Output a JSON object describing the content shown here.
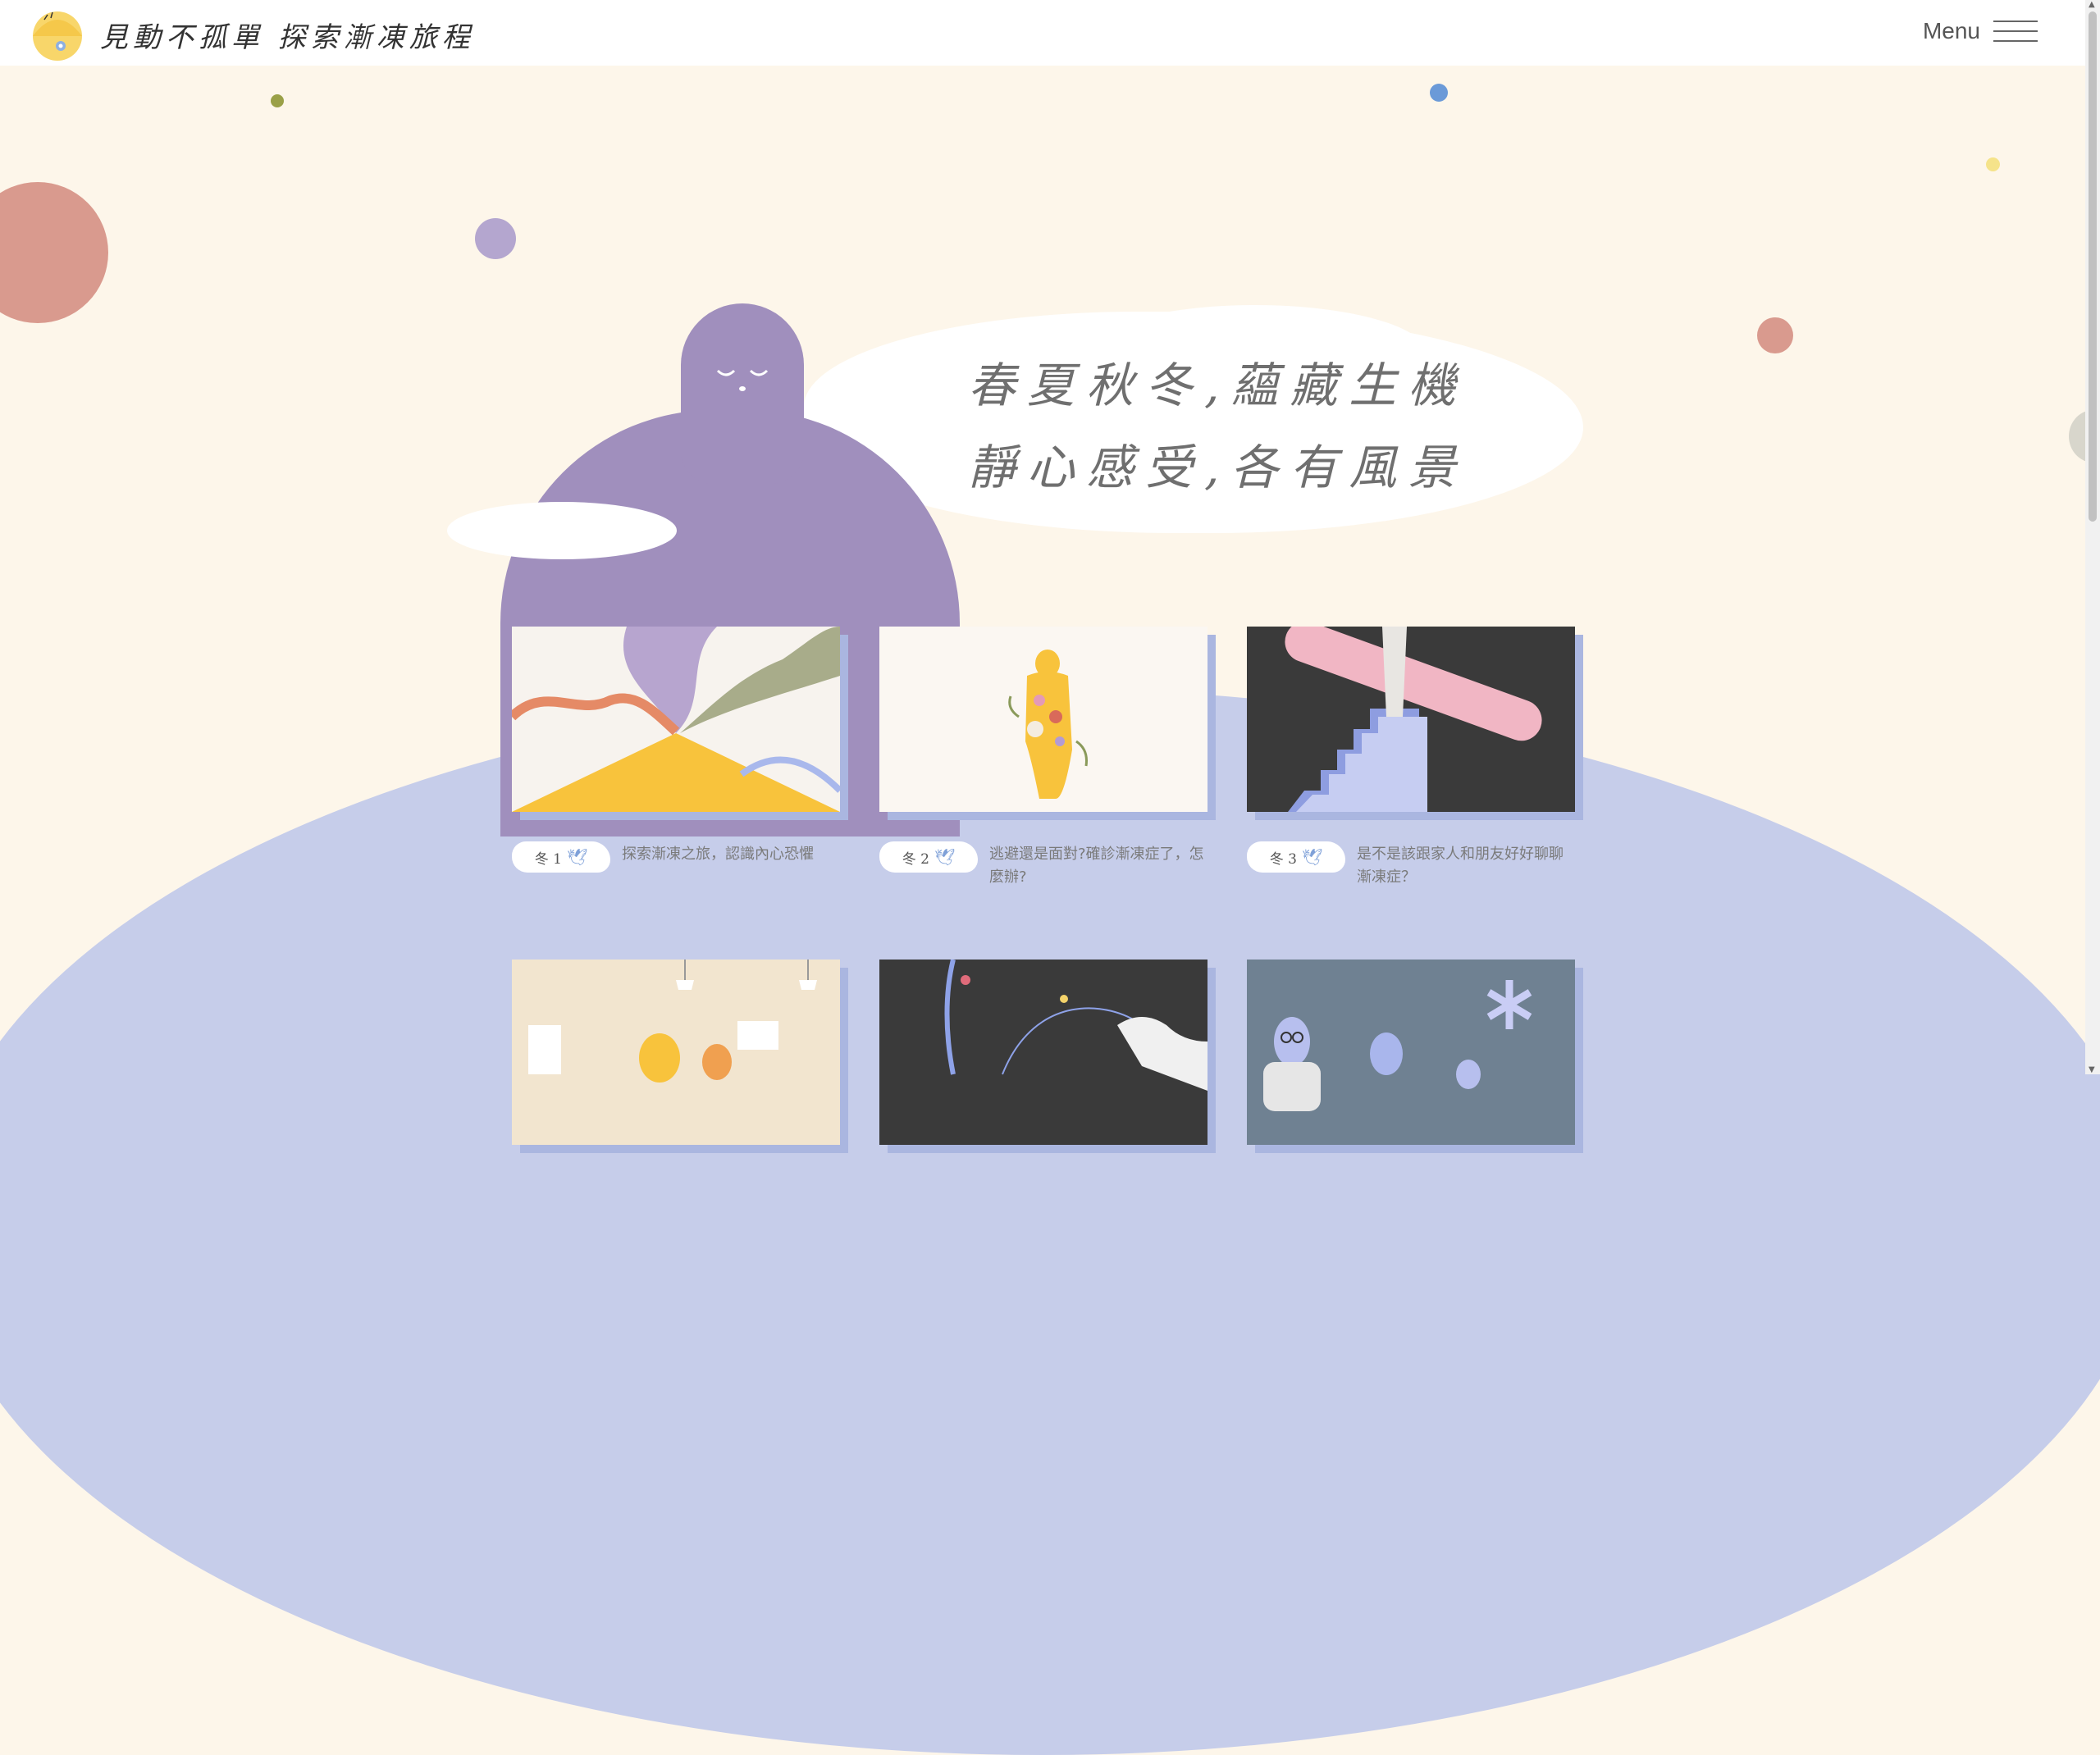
{
  "header": {
    "site_title": "見動不孤單 探索漸凍旅程",
    "menu_label": "Menu"
  },
  "hero": {
    "line1": "春夏秋冬,蘊藏生機",
    "line2": "靜心感受,各有風景"
  },
  "cards": [
    {
      "tag": "冬 1",
      "caption": "探索漸凍之旅，認識內心恐懼"
    },
    {
      "tag": "冬 2",
      "caption": "逃避還是面對?確診漸凍症了，怎麼辦?"
    },
    {
      "tag": "冬 3",
      "caption": "是不是該跟家人和朋友好好聊聊漸凍症？"
    }
  ],
  "colors": {
    "background": "#fdf6ea",
    "figure": "#a08fbd",
    "hill": "#c6cdea",
    "accent_coral": "#d99a8e",
    "accent_yellow": "#f8c33c"
  },
  "icons": {
    "logo": "smiling-sun-flower-icon",
    "menu": "hamburger-icon",
    "tag_bird": "bird-icon"
  }
}
